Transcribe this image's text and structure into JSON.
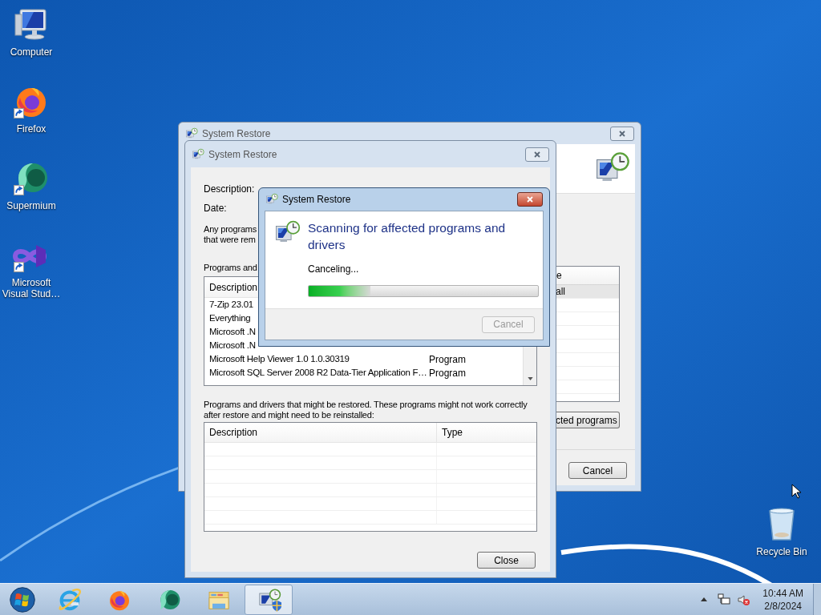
{
  "desktop_icons": [
    {
      "kind": "computer",
      "label": "Computer",
      "shortcut": false
    },
    {
      "kind": "firefox",
      "label": "Firefox",
      "shortcut": true
    },
    {
      "kind": "supermium",
      "label": "Supermium",
      "shortcut": true
    },
    {
      "kind": "visual-studio",
      "label": "Microsoft Visual Stud…",
      "shortcut": true
    }
  ],
  "recycle_bin": {
    "label": "Recycle Bin"
  },
  "back_window": {
    "title": "System Restore",
    "active": false,
    "table": {
      "header_fragment": "e",
      "rows": [
        {
          "text": "all",
          "selected": true
        }
      ]
    },
    "scan_button_fragment": "cted programs",
    "cancel_button": "Cancel"
  },
  "restore_window": {
    "title": "System Restore",
    "active": false,
    "field_labels": [
      "Description:",
      "Date:"
    ],
    "note_lines": [
      "Any programs",
      "that were rem"
    ],
    "table1_label": "Programs and",
    "table1": {
      "header": "Description",
      "rows": [
        {
          "description": "7-Zip 23.01"
        },
        {
          "description": "Everything"
        },
        {
          "description": "Microsoft .N"
        },
        {
          "description": "Microsoft .N"
        },
        {
          "description": "Microsoft Help Viewer 1.0 1.0.30319",
          "type": "Program"
        },
        {
          "description": "Microsoft SQL Server 2008 R2 Data-Tier Application F…",
          "type": "Program"
        }
      ]
    },
    "table2_label": "Programs and drivers that might be restored. These programs might not work correctly after restore and might need to be reinstalled:",
    "table2": {
      "columns": [
        "Description",
        "Type"
      ]
    },
    "close_button": "Close"
  },
  "progress_dialog": {
    "title": "System Restore",
    "active": true,
    "heading": "Scanning for affected programs and drivers",
    "status": "Canceling...",
    "progress": {
      "level": 0.27
    },
    "cancel_button": {
      "label": "Cancel",
      "disabled": true
    }
  },
  "taskbar": {
    "items": [
      {
        "kind": "start",
        "selected": false
      },
      {
        "kind": "internet-explorer",
        "selected": false
      },
      {
        "kind": "firefox",
        "selected": false
      },
      {
        "kind": "supermium",
        "selected": false
      },
      {
        "kind": "folder",
        "selected": false
      },
      {
        "kind": "system-restore",
        "selected": true
      }
    ],
    "tray": {
      "volume_muted": true,
      "time": "10:44 AM",
      "date": "2/8/2024"
    }
  }
}
